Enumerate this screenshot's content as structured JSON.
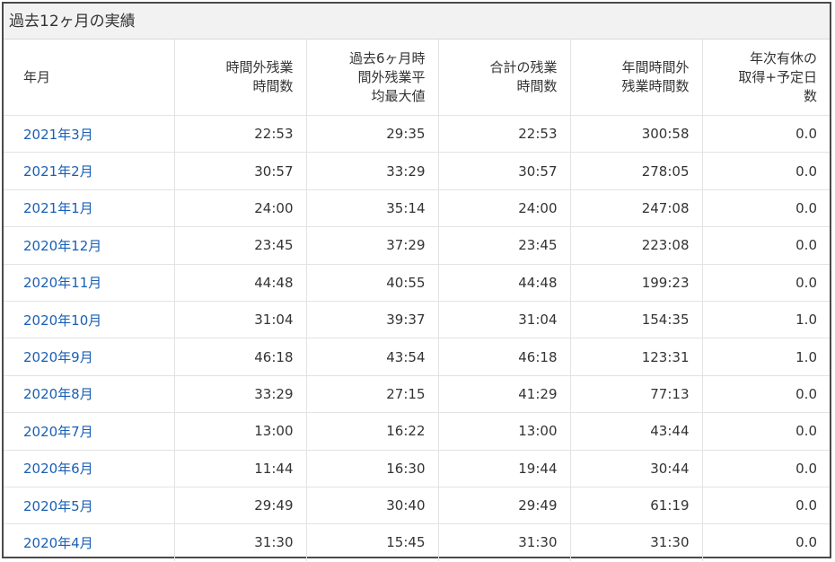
{
  "title": "過去12ヶ月の実績",
  "headers": {
    "month": "年月",
    "overtime": [
      "時間外残業",
      "時間数"
    ],
    "avg6_max": [
      "過去6ヶ月時",
      "間外残業平",
      "均最大値"
    ],
    "total_overtime": [
      "合計の残業",
      "時間数"
    ],
    "annual_overtime": [
      "年間時間外",
      "残業時間数"
    ],
    "paid_leave": [
      "年次有休の",
      "取得+予定日",
      "数"
    ]
  },
  "rows": [
    {
      "month": "2021年3月",
      "overtime": "22:53",
      "avg6_max": "29:35",
      "total_overtime": "22:53",
      "annual_overtime": "300:58",
      "paid_leave": "0.0"
    },
    {
      "month": "2021年2月",
      "overtime": "30:57",
      "avg6_max": "33:29",
      "total_overtime": "30:57",
      "annual_overtime": "278:05",
      "paid_leave": "0.0"
    },
    {
      "month": "2021年1月",
      "overtime": "24:00",
      "avg6_max": "35:14",
      "total_overtime": "24:00",
      "annual_overtime": "247:08",
      "paid_leave": "0.0"
    },
    {
      "month": "2020年12月",
      "overtime": "23:45",
      "avg6_max": "37:29",
      "total_overtime": "23:45",
      "annual_overtime": "223:08",
      "paid_leave": "0.0"
    },
    {
      "month": "2020年11月",
      "overtime": "44:48",
      "avg6_max": "40:55",
      "total_overtime": "44:48",
      "annual_overtime": "199:23",
      "paid_leave": "0.0"
    },
    {
      "month": "2020年10月",
      "overtime": "31:04",
      "avg6_max": "39:37",
      "total_overtime": "31:04",
      "annual_overtime": "154:35",
      "paid_leave": "1.0"
    },
    {
      "month": "2020年9月",
      "overtime": "46:18",
      "avg6_max": "43:54",
      "total_overtime": "46:18",
      "annual_overtime": "123:31",
      "paid_leave": "1.0"
    },
    {
      "month": "2020年8月",
      "overtime": "33:29",
      "avg6_max": "27:15",
      "total_overtime": "41:29",
      "annual_overtime": "77:13",
      "paid_leave": "0.0"
    },
    {
      "month": "2020年7月",
      "overtime": "13:00",
      "avg6_max": "16:22",
      "total_overtime": "13:00",
      "annual_overtime": "43:44",
      "paid_leave": "0.0"
    },
    {
      "month": "2020年6月",
      "overtime": "11:44",
      "avg6_max": "16:30",
      "total_overtime": "19:44",
      "annual_overtime": "30:44",
      "paid_leave": "0.0"
    },
    {
      "month": "2020年5月",
      "overtime": "29:49",
      "avg6_max": "30:40",
      "total_overtime": "29:49",
      "annual_overtime": "61:19",
      "paid_leave": "0.0"
    },
    {
      "month": "2020年4月",
      "overtime": "31:30",
      "avg6_max": "15:45",
      "total_overtime": "31:30",
      "annual_overtime": "31:30",
      "paid_leave": "0.0"
    }
  ],
  "colors": {
    "link": "#1a5fb4",
    "header_bg": "#f2f2f2",
    "border": "#e3e3e3"
  }
}
